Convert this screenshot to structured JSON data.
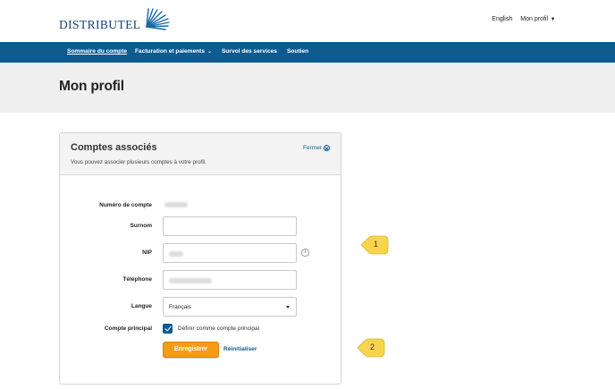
{
  "header": {
    "logo_text": "DISTRIBUTEL",
    "lang_link": "English",
    "profile_menu": "Mon profil"
  },
  "nav": {
    "items": [
      {
        "label": "Sommaire du compte"
      },
      {
        "label": "Facturation et paiements"
      },
      {
        "label": "Survol des services"
      },
      {
        "label": "Soutien"
      }
    ]
  },
  "page": {
    "title": "Mon profil"
  },
  "card": {
    "title": "Comptes associés",
    "subtitle": "Vous pouvez associer plusieurs comptes à votre profil.",
    "close_label": "Fermer",
    "form": {
      "account_number_label": "Numéro de compte",
      "surnom_label": "Surnom",
      "surnom_value": "",
      "nip_label": "NIP",
      "telephone_label": "Téléphone",
      "langue_label": "Langue",
      "langue_value": "Français",
      "principal_label": "Compte principal",
      "principal_checkbox_label": "Définir comme compte principal",
      "principal_checked": true,
      "save_label": "Enregistrer",
      "reset_label": "Réinitialiser"
    }
  },
  "callouts": [
    {
      "number": "1"
    },
    {
      "number": "2"
    }
  ],
  "colors": {
    "brand_blue": "#0e5b92",
    "button_orange": "#f39c17",
    "callout_yellow": "#f7d44c"
  },
  "icons": {
    "close": "close-circle-icon",
    "info": "info-icon",
    "dropdown": "chevron-down-icon",
    "check": "checkmark-icon"
  }
}
